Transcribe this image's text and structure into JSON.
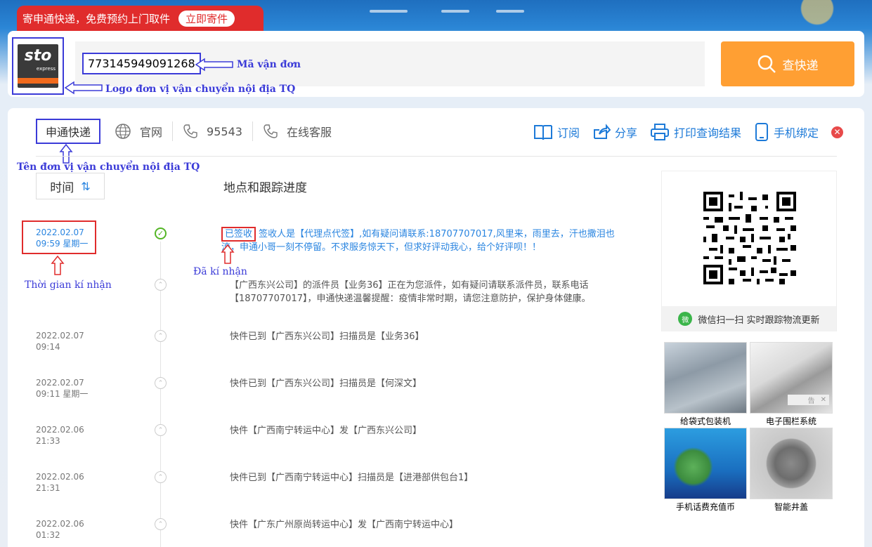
{
  "banner": {
    "text": "寄申通快递，免费预约上门取件",
    "button": "立即寄件"
  },
  "search": {
    "tracking_number": "773145949091268",
    "button_label": "查快递",
    "annot_tracking": "Mã vận đơn",
    "annot_logo": "Logo đơn vị vận chuyển nội địa TQ",
    "logo_text": "sto",
    "logo_sub": "express"
  },
  "toolbar": {
    "company": "申通快递",
    "annot_company": "Tên đơn vị vận chuyển nội địa TQ",
    "website": "官网",
    "phone": "95543",
    "online_service": "在线客服",
    "subscribe": "订阅",
    "share": "分享",
    "print": "打印查询结果",
    "bind_phone": "手机绑定",
    "close": "✕"
  },
  "table": {
    "time_header": "时间",
    "sort_icon": "⇅",
    "location_header": "地点和跟踪进度",
    "rows": [
      {
        "date": "2022.02.07",
        "time": "09:59 星期一",
        "status": "已签收",
        "text": "签收人是【代理点代签】,如有疑问请联系:18707707017,风里来，雨里去，汗也撒泪也流，申通小哥一刻不停留。不求服务惊天下，但求好评动我心，给个好评呗！！"
      },
      {
        "date": "",
        "time": "",
        "text": "【广西东兴公司】的派件员【业务36】正在为您派件，如有疑问请联系派件员，联系电话【18707707017】，申通快递温馨提醒：疫情非常时期，请您注意防护，保护身体健康。"
      },
      {
        "date": "2022.02.07",
        "time": "09:14",
        "text": "快件已到【广西东兴公司】扫描员是【业务36】"
      },
      {
        "date": "2022.02.07",
        "time": "09:11 星期一",
        "text": "快件已到【广西东兴公司】扫描员是【何深文】"
      },
      {
        "date": "2022.02.06",
        "time": "21:33",
        "text": "快件【广西南宁转运中心】发【广西东兴公司】"
      },
      {
        "date": "2022.02.06",
        "time": "21:31",
        "text": "快件已到【广西南宁转运中心】扫描员是【进港部供包台1】"
      },
      {
        "date": "2022.02.06",
        "time": "01:32",
        "text": "快件【广东广州原尚转运中心】发【广西南宁转运中心】"
      }
    ],
    "annot_sign_time": "Thời gian kí nhận",
    "annot_signed": "Đã kí nhận"
  },
  "qr": {
    "caption": "微信扫一扫 实时跟踪物流更新",
    "wechat_icon": "微"
  },
  "ads": [
    {
      "caption": "给袋式包装机"
    },
    {
      "caption": "电子围栏系统"
    },
    {
      "caption": "手机话费充值币"
    },
    {
      "caption": "智能井盖"
    }
  ],
  "ad_close": {
    "label": "告",
    "close": "✕"
  },
  "colors": {
    "accent_orange": "#ff9f33",
    "link_blue": "#1d7ad8",
    "annot_blue": "#3b3bd8",
    "annot_red": "#e02c2c"
  }
}
